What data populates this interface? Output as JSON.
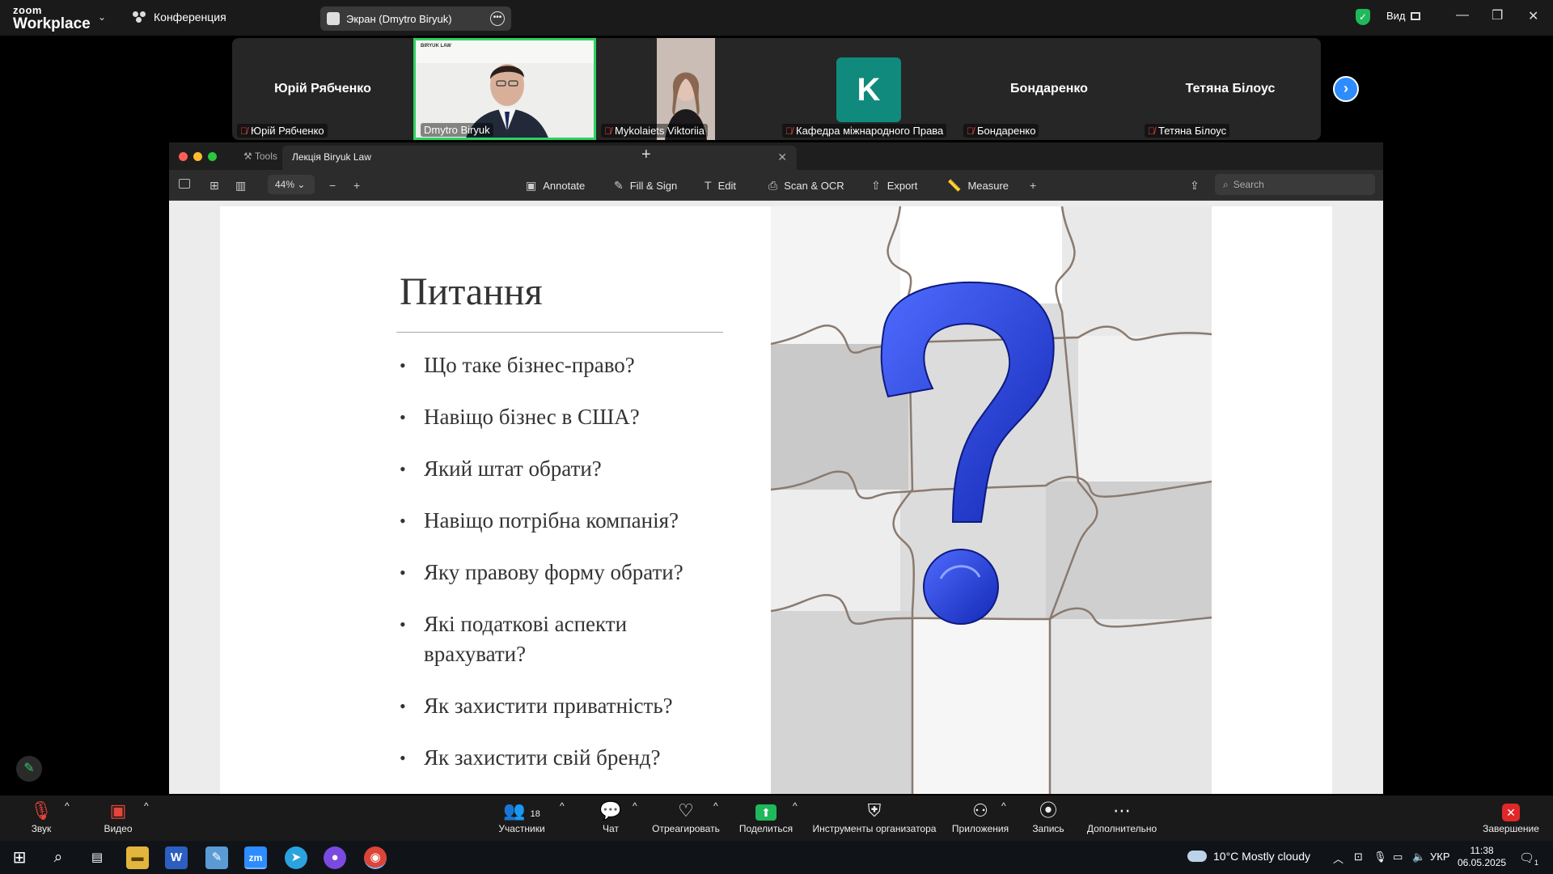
{
  "topbar": {
    "logo_small": "zoom",
    "logo_big": "Workplace",
    "conference_label": "Конференция",
    "sharing_label": "Экран (Dmytro Biryuk)",
    "view_label": "Вид"
  },
  "participants": {
    "tiles": [
      {
        "display_name": "Юрій Рябченко",
        "caption": "Юрій Рябченко"
      },
      {
        "caption": "Dmytro Biryuk",
        "badge": "BIRYUK LAW"
      },
      {
        "caption": "Mykolaiets Viktoriia"
      },
      {
        "avatar_letter": "K",
        "caption": "Кафедра міжнародного Права"
      },
      {
        "display_name": "Бондаренко",
        "caption": "Бондаренко"
      },
      {
        "display_name": "Тетяна Білоус",
        "caption": "Тетяна Білоус"
      }
    ]
  },
  "pdf": {
    "tab_tools": "Tools",
    "tab_document": "Лекція Biryuk Law",
    "zoom_level": "44%",
    "toolbar": {
      "annotate": "Annotate",
      "fill_sign": "Fill & Sign",
      "edit": "Edit",
      "scan_ocr": "Scan & OCR",
      "export": "Export",
      "measure": "Measure"
    },
    "search_placeholder": "Search"
  },
  "slide": {
    "title": "Питання",
    "bullets": [
      "Що таке бізнес-право?",
      "Навіщо бізнес в США?",
      "Який штат обрати?",
      "Навіщо потрібна компанія?",
      "Яку правову форму обрати?",
      "Які податкові аспекти врахувати?",
      "Як захистити приватність?",
      "Як захистити свій бренд?"
    ]
  },
  "bottombar": {
    "audio": "Звук",
    "video": "Видео",
    "participants_label": "Участники",
    "participants_count": "18",
    "chat": "Чат",
    "react": "Отреагировать",
    "share": "Поделиться",
    "host_tools": "Инструменты организатора",
    "apps": "Приложения",
    "record": "Запись",
    "more": "Дополнительно",
    "end": "Завершение"
  },
  "taskbar": {
    "weather": "10°C  Mostly cloudy",
    "language": "УКР",
    "time": "11:38",
    "date": "06.05.2025",
    "notifications": "1"
  },
  "colors": {
    "zoom_green": "#2fd25f",
    "zoom_blue": "#2d8cff",
    "end_red": "#e02828",
    "question_blue": "#1d3fd8"
  }
}
